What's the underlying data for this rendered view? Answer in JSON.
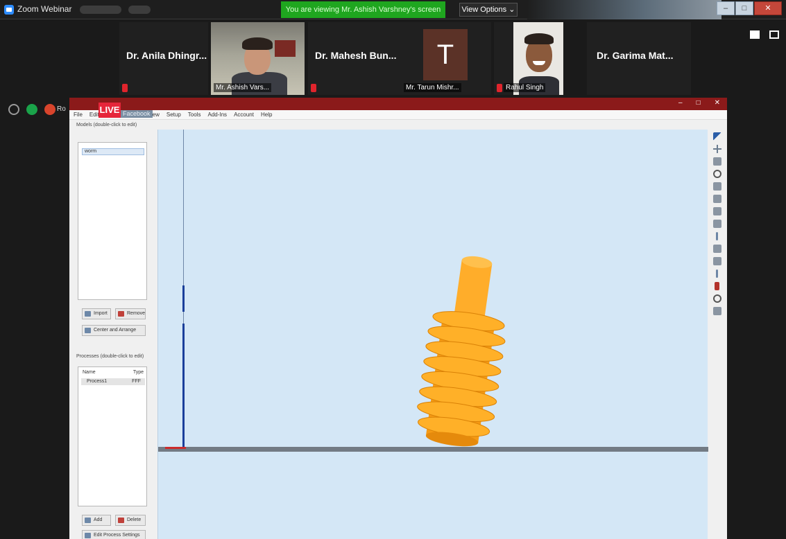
{
  "zoom": {
    "window_title": "Zoom Webinar",
    "viewing_banner": "You are viewing Mr. Ashish Varshney's screen",
    "view_options": "View Options ⌄",
    "window_controls": {
      "minimize": "–",
      "maximize": "□",
      "close": "✕"
    }
  },
  "participants": {
    "p1_name": "Dr. Anila Dhingr...",
    "p2_label": "Mr. Ashish Vars...",
    "p3_name": "Dr. Mahesh Bun...",
    "p4_initial": "T",
    "p4_label": "Mr. Tarun Mishr...",
    "p5_label": "Rahul Singh",
    "p6_name": "Dr. Garima Mat..."
  },
  "share": {
    "share_label": "Ro",
    "live_badge": "LIVE",
    "stream_label": "Facebook"
  },
  "app": {
    "menu": [
      "File",
      "Edit",
      "View",
      "Setup",
      "Tools",
      "Add-Ins",
      "Account",
      "Help"
    ],
    "window_controls": {
      "minimize": "–",
      "maximize": "□",
      "close": "✕"
    },
    "models_caption": "Models (double-click to edit)",
    "model_item": "worm",
    "btn_import": "Import",
    "btn_remove": "Remove",
    "btn_center": "Center and Arrange",
    "processes_caption": "Processes (double-click to edit)",
    "table_headers": [
      "Name",
      "Type"
    ],
    "table_row": [
      "Process1",
      "FFF"
    ],
    "btn_add": "Add",
    "btn_delete": "Delete",
    "btn_edit_settings": "Edit Process Settings"
  },
  "colors": {
    "accent_green": "#1fa61f",
    "live_red": "#e6253a",
    "app_titlebar": "#8b1a1a",
    "model_orange": "#ffa81f",
    "viewport_bg": "#d4e7f6"
  }
}
